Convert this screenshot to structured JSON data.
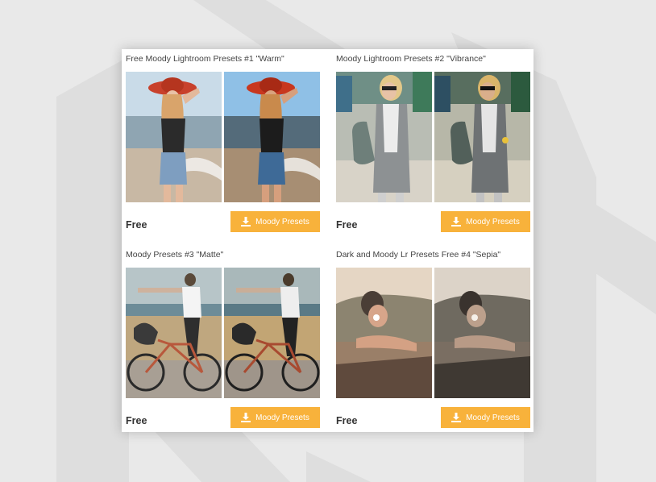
{
  "items": [
    {
      "title": "Free Moody Lightroom Presets #1 \"Warm\"",
      "price": "Free",
      "button_label": "Moody Presets"
    },
    {
      "title": "Moody Lightroom Presets #2 \"Vibrance\"",
      "price": "Free",
      "button_label": "Moody Presets"
    },
    {
      "title": "Moody Presets #3 \"Matte\"",
      "price": "Free",
      "button_label": "Moody Presets"
    },
    {
      "title": "Dark and Moody Lr Presets Free #4 \"Sepia\"",
      "price": "Free",
      "button_label": "Moody Presets"
    }
  ],
  "colors": {
    "accent": "#f8b23b",
    "background": "#e9e9e9",
    "card": "#ffffff"
  },
  "icons": {
    "download": "download-icon"
  }
}
